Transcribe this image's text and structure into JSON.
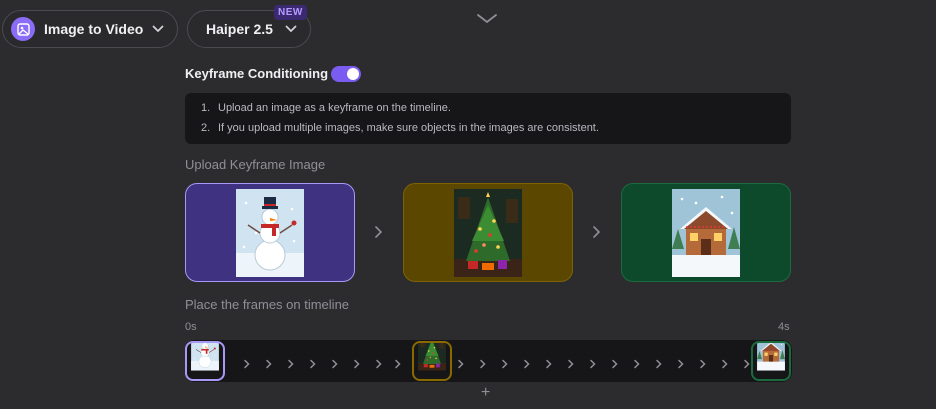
{
  "toolbar": {
    "mode_label": "Image to Video",
    "model_label": "Haiper 2.5",
    "model_badge": "NEW"
  },
  "keyframe": {
    "label": "Keyframe Conditioning",
    "enabled": true,
    "tips": [
      {
        "num": "1.",
        "text": "Upload an image as a keyframe on the timeline."
      },
      {
        "num": "2.",
        "text": "If you upload multiple images, make sure objects in the images are consistent."
      }
    ]
  },
  "upload": {
    "label": "Upload Keyframe Image",
    "frames": [
      {
        "image": "snowman",
        "selected": true
      },
      {
        "image": "christmas-tree"
      },
      {
        "image": "gingerbread-house"
      }
    ]
  },
  "timeline": {
    "label": "Place the frames on timeline",
    "start": "0s",
    "end": "4s",
    "add_icon": "+"
  },
  "colors": {
    "accent": "#7b5cf0",
    "frame1_bg": "#3f3280",
    "frame2_bg": "#5c4700",
    "frame3_bg": "#0d4a2b"
  }
}
